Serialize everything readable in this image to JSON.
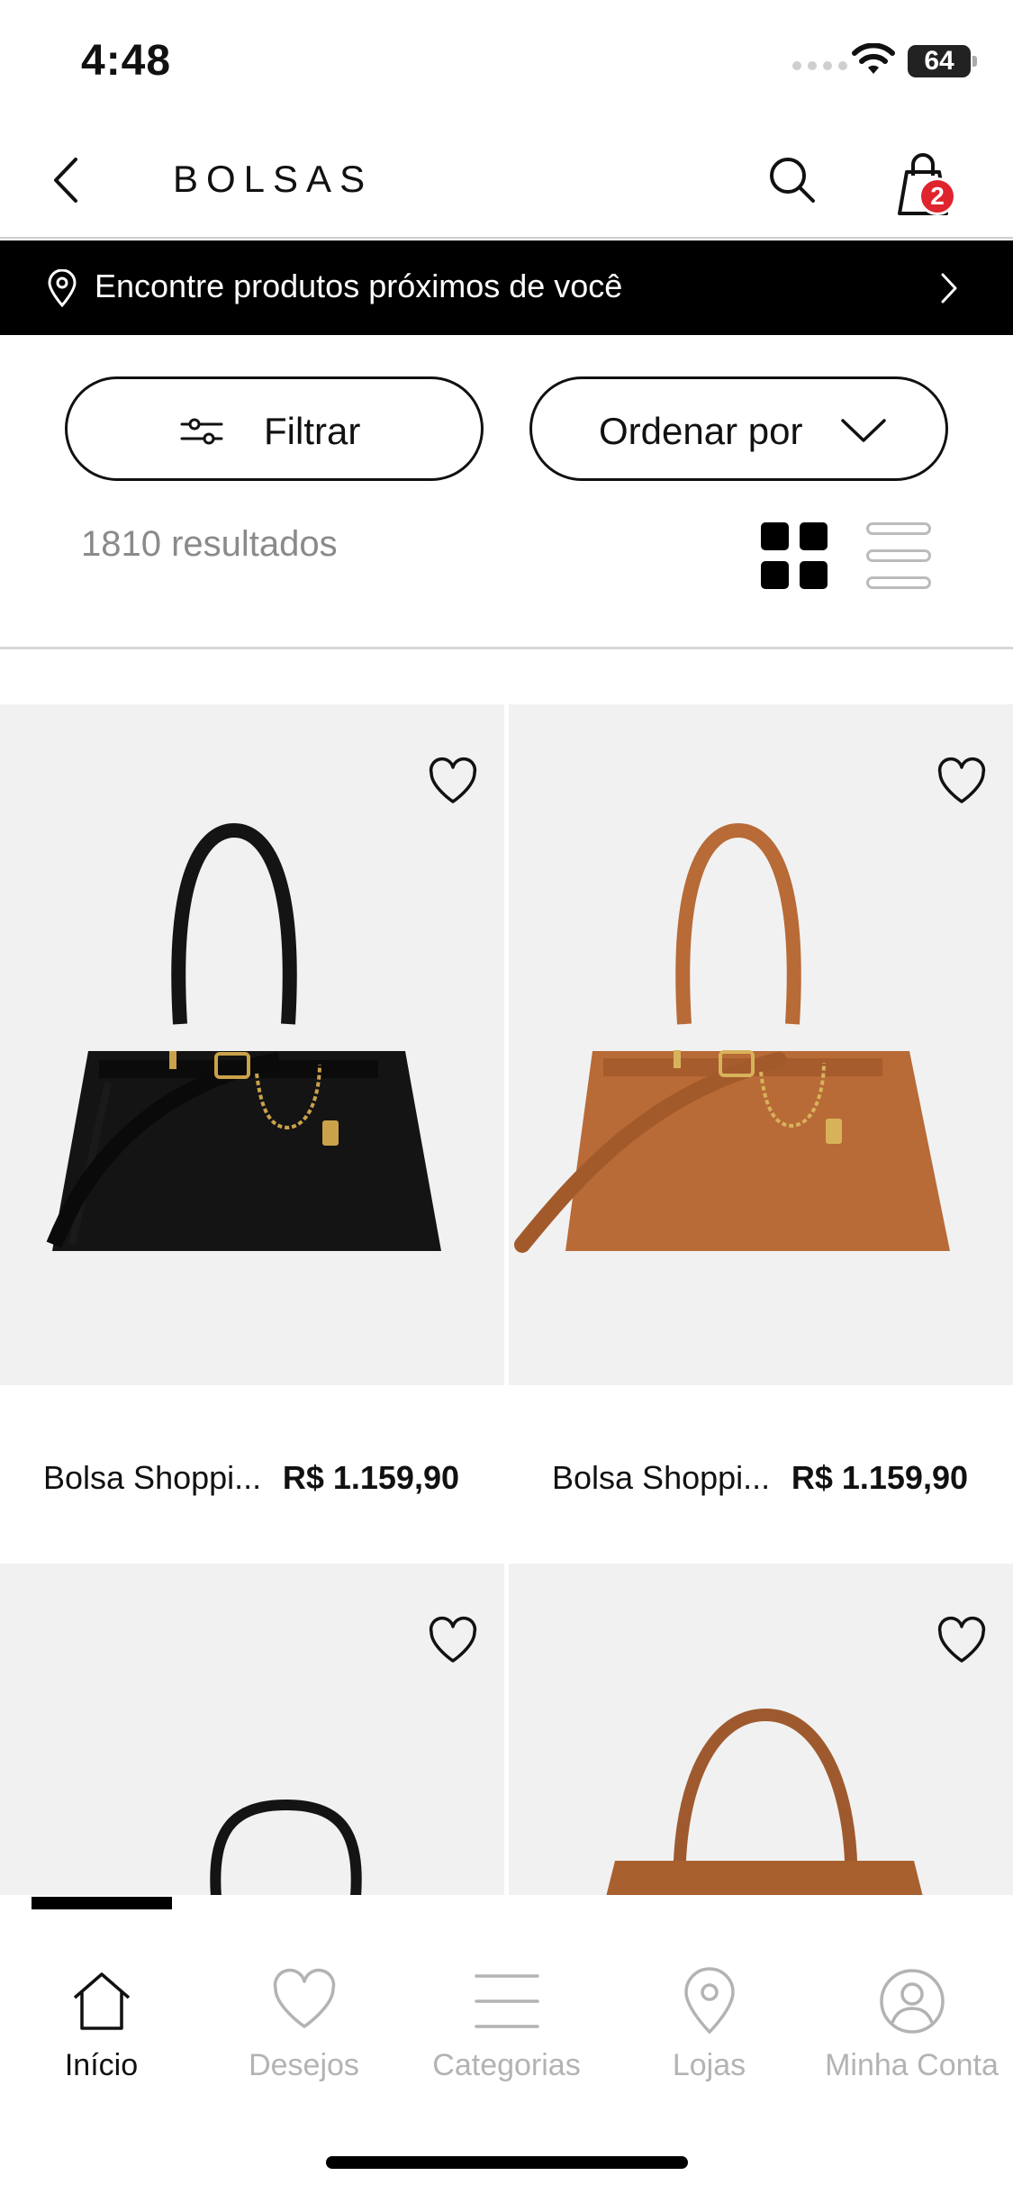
{
  "status_bar": {
    "time": "4:48",
    "battery": "64"
  },
  "header": {
    "title": "BOLSAS",
    "cart_count": "2"
  },
  "location_banner": {
    "text": "Encontre produtos próximos de você"
  },
  "toolbar": {
    "filter_label": "Filtrar",
    "sort_label": "Ordenar por",
    "results": "1810 resultados"
  },
  "products": [
    {
      "name": "Bolsa Shoppi...",
      "price": "R$ 1.159,90",
      "color": "#141414"
    },
    {
      "name": "Bolsa Shoppi...",
      "price": "R$ 1.159,90",
      "color": "#b86a37"
    }
  ],
  "bottom_nav": {
    "items": [
      {
        "label": "Início",
        "icon": "home-icon",
        "active": true
      },
      {
        "label": "Desejos",
        "icon": "heart-icon",
        "active": false
      },
      {
        "label": "Categorias",
        "icon": "menu-icon",
        "active": false
      },
      {
        "label": "Lojas",
        "icon": "location-pin-icon",
        "active": false
      },
      {
        "label": "Minha Conta",
        "icon": "user-icon",
        "active": false
      }
    ]
  },
  "colors": {
    "accent": "#000000",
    "badge": "#e0242e",
    "inactive": "#b3b3b3"
  }
}
